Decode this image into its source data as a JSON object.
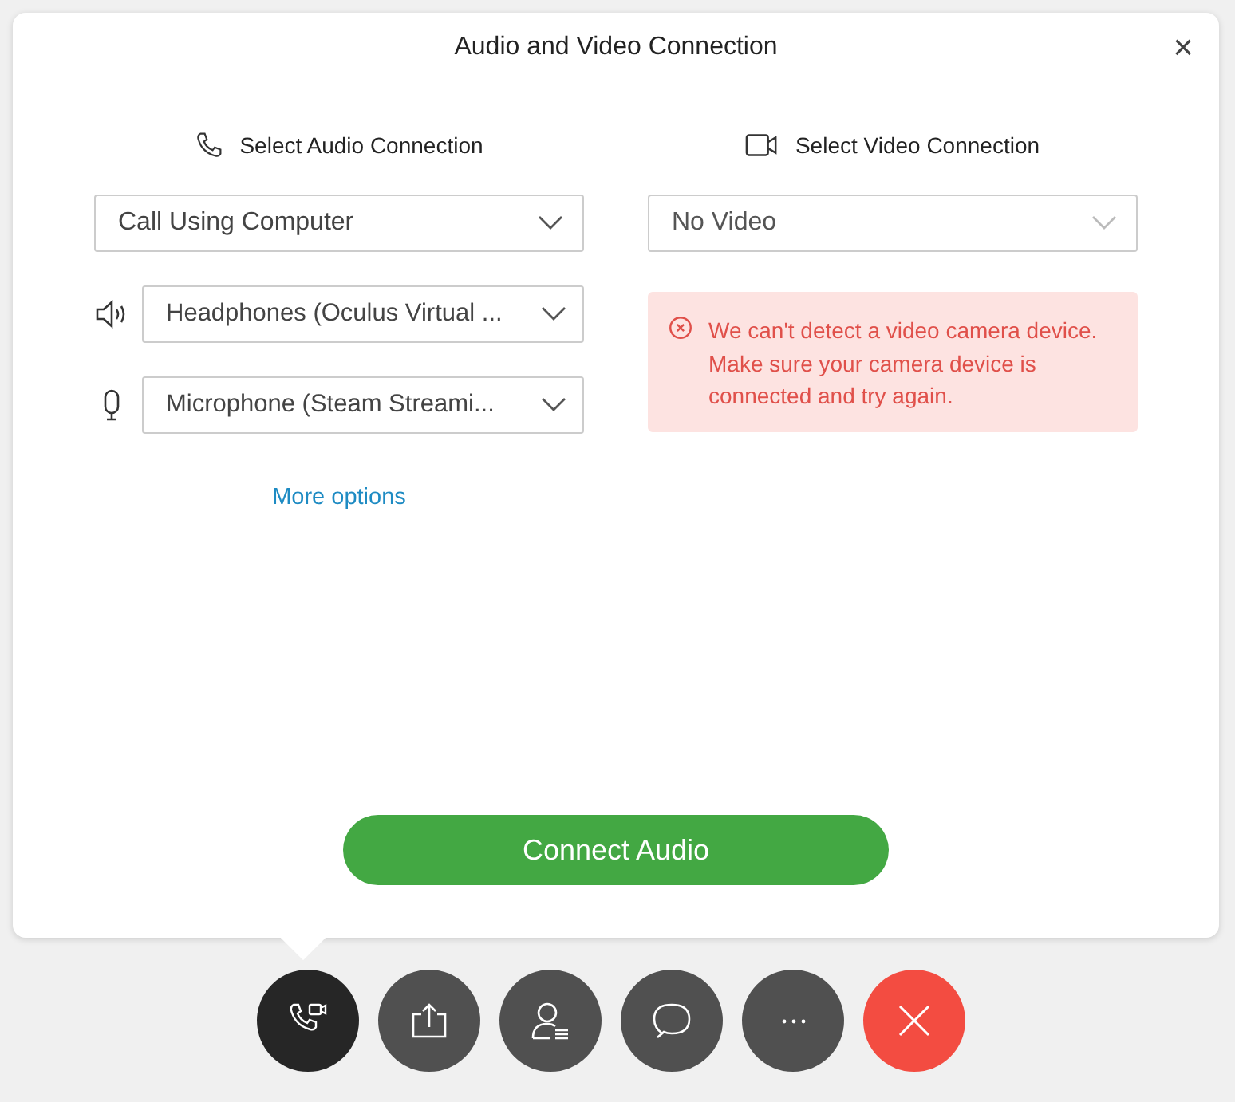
{
  "dialog": {
    "title": "Audio and Video Connection",
    "close": "×"
  },
  "audio": {
    "heading": "Select Audio Connection",
    "connection": {
      "value": "Call Using Computer",
      "disabled": false
    },
    "devices": [
      {
        "kind": "speaker",
        "value": "Headphones (Oculus Virtual ..."
      },
      {
        "kind": "microphone",
        "value": "Microphone (Steam Streami..."
      }
    ],
    "more_options": "More options"
  },
  "video": {
    "heading": "Select Video Connection",
    "connection": {
      "value": "No Video",
      "disabled": true
    },
    "error": "We can't detect a video camera device. Make sure your camera device is connected and try again."
  },
  "connect_button": "Connect Audio",
  "toolbar": [
    {
      "kind": "call",
      "selected": true
    },
    {
      "kind": "share",
      "selected": false
    },
    {
      "kind": "participants",
      "selected": false
    },
    {
      "kind": "chat",
      "selected": false
    },
    {
      "kind": "more",
      "selected": false
    },
    {
      "kind": "leave",
      "selected": false
    }
  ]
}
